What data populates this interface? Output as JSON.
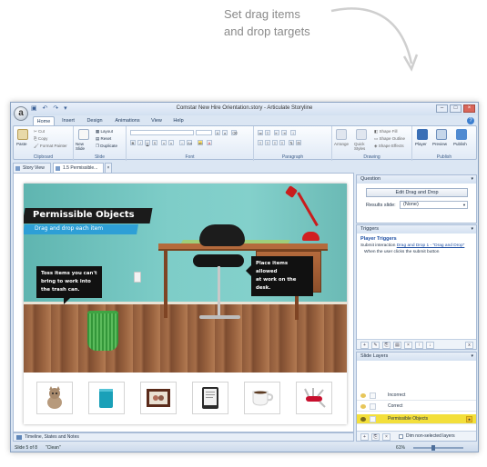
{
  "callout": {
    "line1": "Set drag items",
    "line2": "and drop targets"
  },
  "window": {
    "title": "Comstar New Hire Orientation.story",
    "app_name": "Articulate Storyline"
  },
  "ribbon_tabs": [
    "Home",
    "Insert",
    "Design",
    "Animations",
    "View",
    "Help"
  ],
  "ribbon": {
    "clipboard": {
      "paste": "Paste",
      "cut": "Cut",
      "copy": "Copy",
      "format_painter": "Format Painter",
      "label": "Clipboard"
    },
    "slide": {
      "new_slide": "New Slide",
      "layout": "Layout",
      "reset": "Reset",
      "duplicate": "Duplicate",
      "label": "Slide"
    },
    "font": {
      "label": "Font"
    },
    "paragraph": {
      "label": "Paragraph"
    },
    "drawing": {
      "arrange": "Arrange",
      "quick_styles": "Quick Styles",
      "shape_fill": "Shape Fill",
      "shape_outline": "Shape Outline",
      "shape_effects": "Shape Effects",
      "label": "Drawing"
    },
    "publish": {
      "player": "Player",
      "preview": "Preview",
      "publish": "Publish",
      "label": "Publish"
    }
  },
  "doc_tabs": [
    "Story View",
    "1.5 Permissible..."
  ],
  "slide": {
    "title": "Permissible Objects",
    "subtitle": "Drag and drop each item",
    "bubble_left": [
      "Toss items you can't",
      "bring to work into",
      "the trash can."
    ],
    "bubble_right": [
      "Place items allowed",
      "at work on the desk."
    ],
    "drag_items": [
      "kitten-item",
      "mug-item",
      "photo-frame-item",
      "tablet-item",
      "coffee-cup-item",
      "pocket-knife-item"
    ]
  },
  "stage_bottom": "Timeline, States and Notes",
  "status": {
    "slide": "Slide 5 of 8",
    "theme": "\"Clean\"",
    "zoom": "61%"
  },
  "question_panel": {
    "header": "Question",
    "edit_button": "Edit Drag and Drop",
    "results_label": "Results slide:",
    "results_value": "(None)"
  },
  "triggers_panel": {
    "header": "Triggers",
    "section": "Player Triggers",
    "line_prefix": "Submit interaction",
    "line_link": "Drag and Drop 1 - \"Drag and Drop\"",
    "line2": "When the user clicks the submit button"
  },
  "layers_panel": {
    "header": "Slide Layers",
    "layers": [
      "Incorrect",
      "Correct"
    ],
    "base_layer": "Permissible Objects",
    "dim_label": "Dim non-selected layers"
  },
  "colors": {
    "title_banner": "#1b1b1b",
    "subtitle_bar": "#2e9fd6",
    "base_layer_highlight": "#f3df3b",
    "trigger_link": "#1d4ea3"
  }
}
